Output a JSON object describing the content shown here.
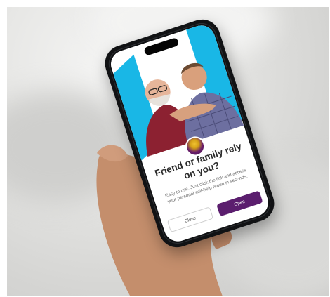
{
  "popup": {
    "title": "Friend or family rely on you?",
    "description": "Easy to use. Just click the link and access your personal self-help report in seconds.",
    "close_label": "Close",
    "open_label": "Open"
  },
  "colors": {
    "accent": "#5b1e6e",
    "photo_frame": "#19b7e6"
  }
}
